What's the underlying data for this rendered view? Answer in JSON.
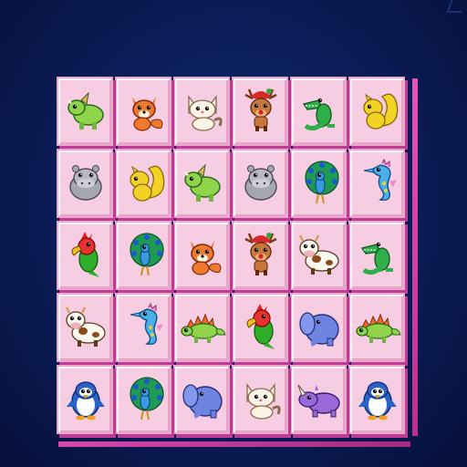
{
  "board": {
    "rows": 5,
    "cols": 6,
    "tiles": [
      [
        "triceratops-icon",
        "fox-icon",
        "cat-icon",
        "reindeer-icon",
        "crocodile-icon",
        "squirrel-icon"
      ],
      [
        "hippo-icon",
        "squirrel-icon",
        "triceratops-icon",
        "hippo-icon",
        "peacock-icon",
        "seahorse-icon"
      ],
      [
        "parrot-icon",
        "peacock-icon",
        "fox-icon",
        "reindeer-icon",
        "cow-icon",
        "crocodile-icon"
      ],
      [
        "cow-icon",
        "seahorse-icon",
        "stegosaurus-icon",
        "parrot-icon",
        "elephant-icon",
        "stegosaurus-icon"
      ],
      [
        "penguin-icon",
        "peacock-icon",
        "elephant-icon",
        "cat-icon",
        "rhino-icon",
        "penguin-icon"
      ]
    ]
  },
  "colors": {
    "background": "#0c1f5c",
    "tile_face": "#f7cde3",
    "tile_edge": "#c23a98"
  }
}
